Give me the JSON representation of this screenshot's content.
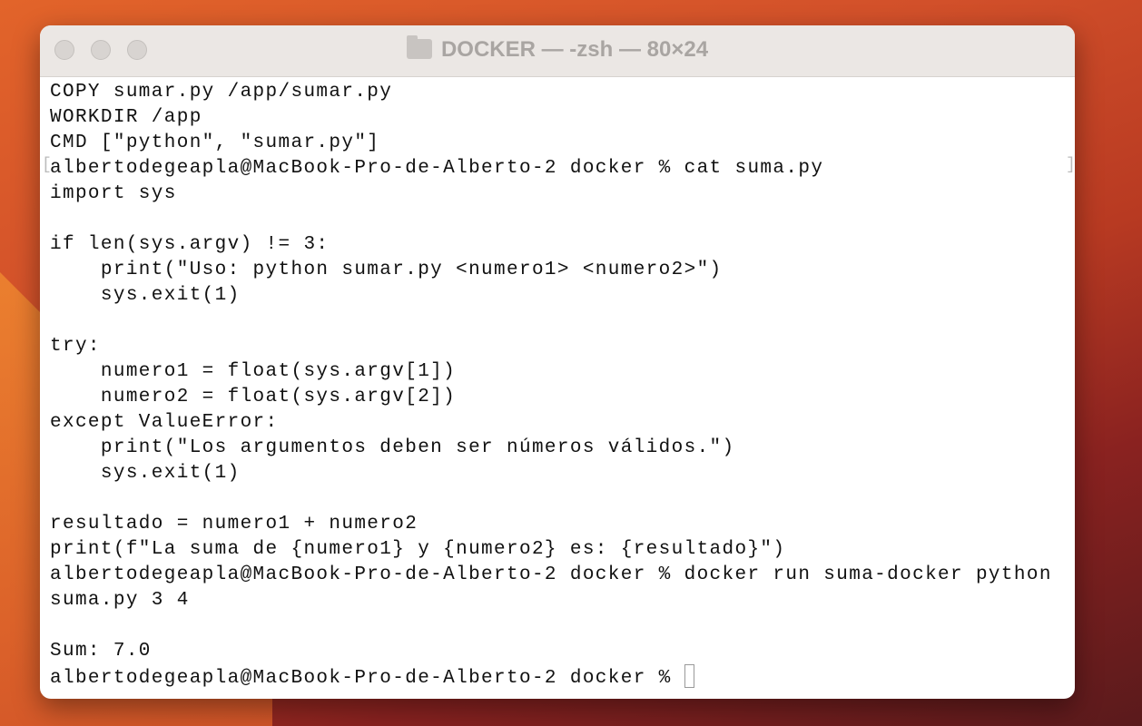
{
  "window": {
    "title": "DOCKER — -zsh — 80×24"
  },
  "terminal": {
    "lines": [
      "COPY sumar.py /app/sumar.py",
      "WORKDIR /app",
      "CMD [\"python\", \"sumar.py\"]",
      "albertodegeapla@MacBook-Pro-de-Alberto-2 docker % cat suma.py",
      "import sys",
      "",
      "if len(sys.argv) != 3:",
      "    print(\"Uso: python sumar.py <numero1> <numero2>\")",
      "    sys.exit(1)",
      "",
      "try:",
      "    numero1 = float(sys.argv[1])",
      "    numero2 = float(sys.argv[2])",
      "except ValueError:",
      "    print(\"Los argumentos deben ser números válidos.\")",
      "    sys.exit(1)",
      "",
      "resultado = numero1 + numero2",
      "print(f\"La suma de {numero1} y {numero2} es: {resultado}\")",
      "albertodegeapla@MacBook-Pro-de-Alberto-2 docker % docker run suma-docker python",
      "suma.py 3 4",
      "",
      "Sum: 7.0"
    ],
    "prompt": "albertodegeapla@MacBook-Pro-de-Alberto-2 docker % "
  }
}
